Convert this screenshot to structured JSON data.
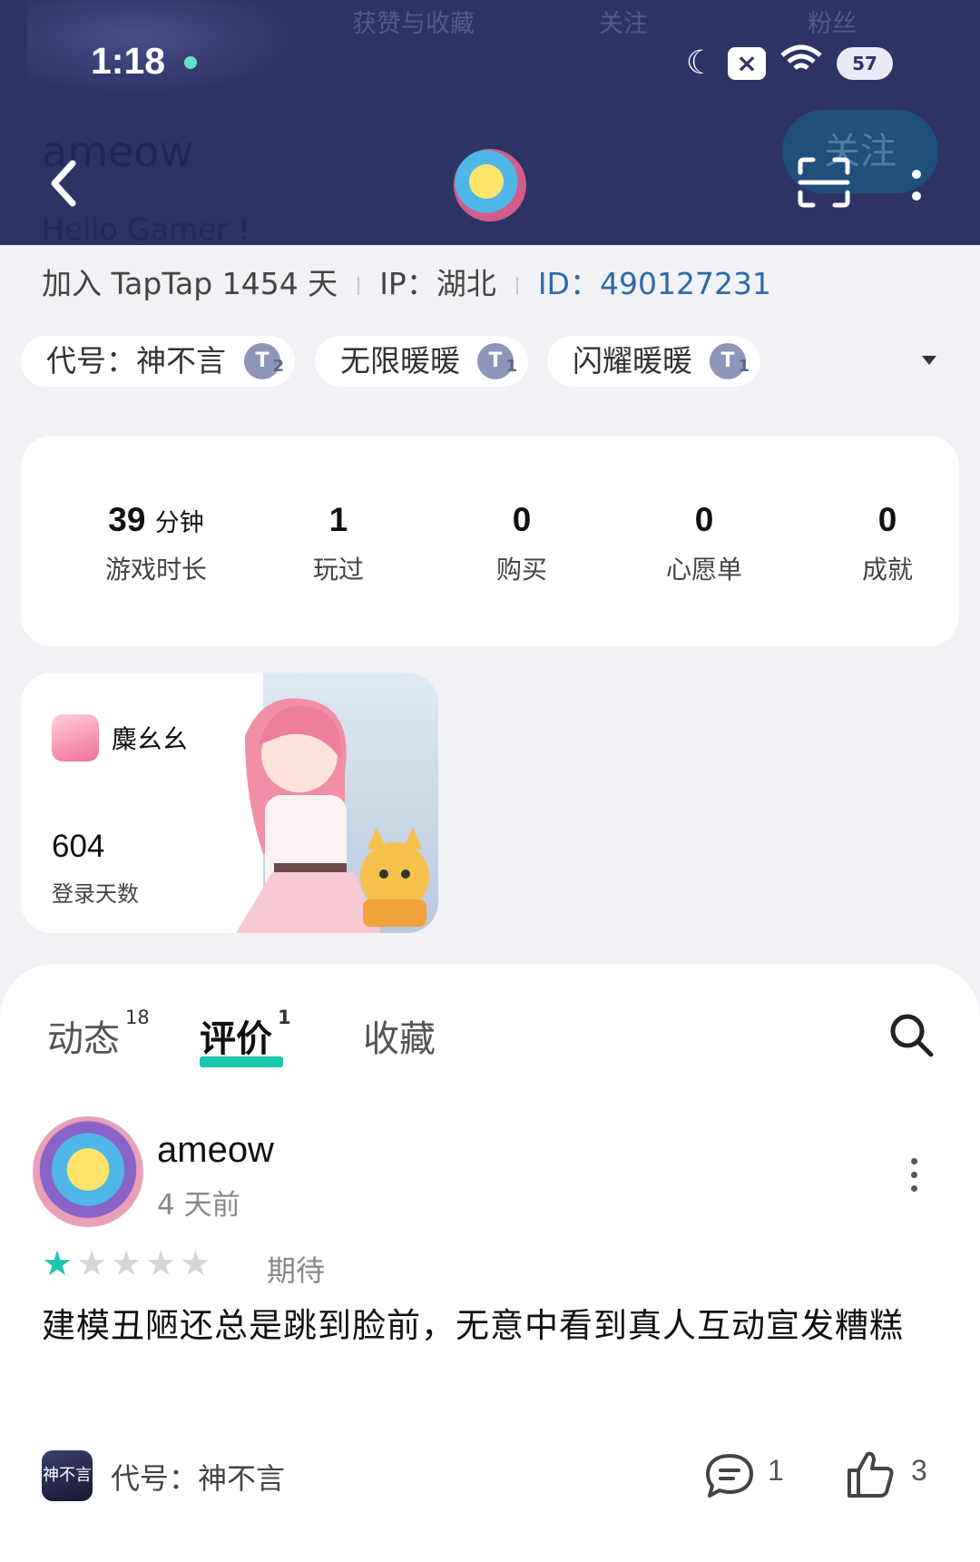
{
  "status_bar": {
    "time": "1:18",
    "moon_icon": "moon-icon",
    "box_label": "×",
    "wifi_icon": "wifi-icon",
    "battery_label": "57"
  },
  "header": {
    "ghost_tabs": [
      "获赞与收藏",
      "关注",
      "粉丝"
    ],
    "username": "ameow",
    "bio": "Hello Gamer !",
    "follow_label": "关注"
  },
  "meta": {
    "joined": "加入 TapTap 1454 天",
    "ip": "IP：湖北",
    "id": "ID：490127231"
  },
  "game_chips": [
    {
      "name": "代号：神不言",
      "level": "T",
      "sub": "2"
    },
    {
      "name": "无限暖暖",
      "level": "T",
      "sub": "1"
    },
    {
      "name": "闪耀暖暖",
      "level": "T",
      "sub": "1"
    }
  ],
  "stats": [
    {
      "value": "39",
      "unit": "分钟",
      "label": "游戏时长"
    },
    {
      "value": "1",
      "unit": "",
      "label": "玩过"
    },
    {
      "value": "0",
      "unit": "",
      "label": "购买"
    },
    {
      "value": "0",
      "unit": "",
      "label": "心愿单"
    },
    {
      "value": "0",
      "unit": "",
      "label": "成就"
    }
  ],
  "game_card": {
    "name": "麋幺幺",
    "days": "604",
    "days_label": "登录天数"
  },
  "tabs": [
    {
      "label": "动态",
      "count": "18"
    },
    {
      "label": "评价",
      "count": "1"
    },
    {
      "label": "收藏",
      "count": ""
    }
  ],
  "post": {
    "username": "ameow",
    "time": "4 天前",
    "rating": 1,
    "rating_max": 5,
    "rating_label": "期待",
    "body": "建模丑陋还总是跳到脸前，无意中看到真人互动宣发糟糕",
    "game_name": "代号：神不言",
    "game_icon_text": "神不言",
    "comments": "1",
    "likes": "3"
  },
  "colors": {
    "header_bg": "#2e3366",
    "accent": "#1cc7b0",
    "id_link": "#2e6aa6"
  }
}
